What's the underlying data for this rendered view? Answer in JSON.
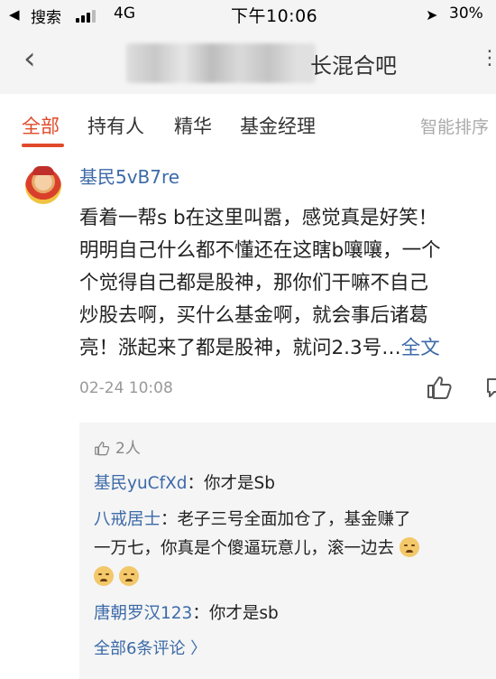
{
  "status_bar": {
    "back_label": "◀",
    "carrier": "搜索",
    "network": "4G",
    "time": "下午10:06",
    "battery": "30%",
    "location_icon": "location-arrow-icon"
  },
  "header": {
    "title_suffix": "长混合吧",
    "back_icon": "chevron-left-icon",
    "more_icon": "more-icon"
  },
  "tabs": {
    "items": [
      {
        "label": "全部",
        "active": true
      },
      {
        "label": "持有人",
        "active": false
      },
      {
        "label": "精华",
        "active": false
      },
      {
        "label": "基金经理",
        "active": false
      }
    ],
    "sort_label": "智能排序"
  },
  "post": {
    "username": "基民5vB7re",
    "lines": [
      "看着一帮s b在这里叫嚣，感觉真是好笑！",
      "明明自己什么都不懂还在这瞎b嚷嚷，一个",
      "个觉得自己都是股神，那你们干嘛不自己",
      "炒股去啊，买什么基金啊，就会事后诸葛",
      "亮！涨起来了都是股神，就问2.3号…"
    ],
    "expand_label": "全文",
    "date": "02-24 10:08",
    "colors": {
      "link": "#3c6aa8",
      "accent": "#e04a2a"
    }
  },
  "replies": {
    "likes": "2人",
    "items": [
      {
        "name": "基民yuCfXd",
        "sep": "：",
        "text": "你才是Sb"
      },
      {
        "name": "八戒居士",
        "sep": "：",
        "text": "老子三号全面加仓了，基金赚了",
        "text2": "一万七，你真是个傻逼玩意儿，滚一边去"
      },
      {
        "name": "唐朝罗汉123",
        "sep": "：",
        "text": "你才是sb"
      }
    ],
    "all_comments": "全部6条评论 〉"
  }
}
